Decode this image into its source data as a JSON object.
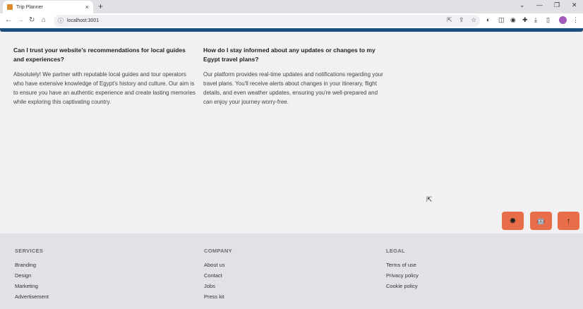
{
  "browser": {
    "tab_title": "Trip Planner",
    "new_tab": "+",
    "url": "localhost:3001",
    "tab_close": "×",
    "win_minimize": "—",
    "win_restore": "❐",
    "win_close": "✕",
    "chevron": "⌄"
  },
  "faq": [
    {
      "question": "Can I trust your website's recommendations for local guides and experiences?",
      "answer": "Absolutely! We partner with reputable local guides and tour operators who have extensive knowledge of Egypt's history and culture. Our aim is to ensure you have an authentic experience and create lasting memories while exploring this captivating country."
    },
    {
      "question": "How do I stay informed about any updates or changes to my Egypt travel plans?",
      "answer": "Our platform provides real-time updates and notifications regarding your travel plans. You'll receive alerts about changes in your itinerary, flight details, and even weather updates, ensuring you're well-prepared and can enjoy your journey worry-free."
    }
  ],
  "fab": {
    "theme_icon": "bug-icon",
    "chat_icon": "robot-icon",
    "top_icon": "arrow-up-icon",
    "theme_glyph": "✹",
    "chat_glyph": "🤖",
    "top_glyph": "↑"
  },
  "footer": {
    "services": {
      "heading": "SERVICES",
      "links": [
        "Branding",
        "Design",
        "Marketing",
        "Advertisement"
      ]
    },
    "company": {
      "heading": "COMPANY",
      "links": [
        "About us",
        "Contact",
        "Jobs",
        "Press kit"
      ]
    },
    "legal": {
      "heading": "LEGAL",
      "links": [
        "Terms of use",
        "Privacy policy",
        "Cookie policy"
      ]
    }
  },
  "colors": {
    "accent": "#e76e48",
    "progress": "#1d4f7e",
    "footer_bg": "#e2e2e6",
    "page_bg": "#f1f0f3"
  }
}
